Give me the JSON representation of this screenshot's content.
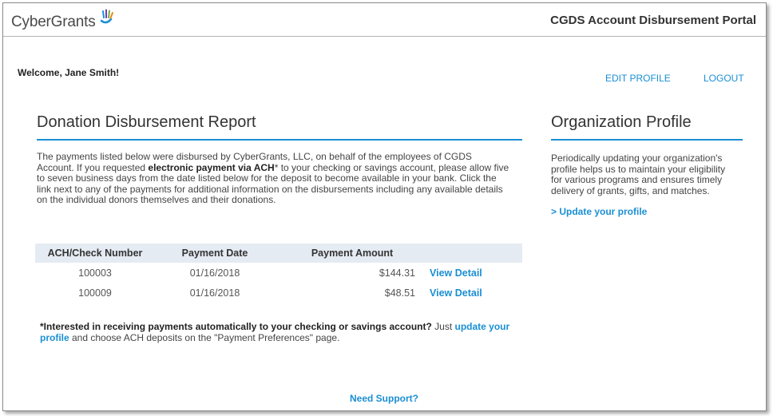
{
  "header": {
    "logo_text": "CyberGrants",
    "portal_title": "CGDS Account Disbursement Portal"
  },
  "user_bar": {
    "welcome": "Welcome, Jane Smith!",
    "edit_profile": "EDIT PROFILE",
    "logout": "LOGOUT"
  },
  "report": {
    "title": "Donation Disbursement Report",
    "intro_part1": "The payments listed below were disbursed by CyberGrants, LLC, on behalf of the employees of CGDS Account. If you requested ",
    "intro_bold": "electronic payment via ACH",
    "intro_part2": "* to your checking or savings account, please allow five to seven business days from the date listed below for the deposit to become available in your bank. Click the link next to any of the payments for additional information on the disbursements including any available details on the individual donors themselves and their donations.",
    "columns": [
      "ACH/Check Number",
      "Payment Date",
      "Payment Amount"
    ],
    "rows": [
      {
        "number": "100003",
        "date": "01/16/2018",
        "amount": "$144.31",
        "action": "View Detail"
      },
      {
        "number": "100009",
        "date": "01/16/2018",
        "amount": "$48.51",
        "action": "View Detail"
      }
    ],
    "note_bold": "*Interested in receiving payments automatically to your checking or savings account?",
    "note_part1": " Just ",
    "note_link": "update your profile",
    "note_part2": " and choose ACH deposits on the \"Payment Preferences\" page."
  },
  "org_profile": {
    "title": "Organization Profile",
    "text": "Periodically updating your organization's profile helps us to maintain your eligibility for various programs and ensures timely delivery of grants, gifts, and matches.",
    "link": "> Update your profile"
  },
  "footer": {
    "support": "Need Support?"
  },
  "colors": {
    "accent": "#1a8fd4",
    "table_header_bg": "#e4ebf3"
  }
}
